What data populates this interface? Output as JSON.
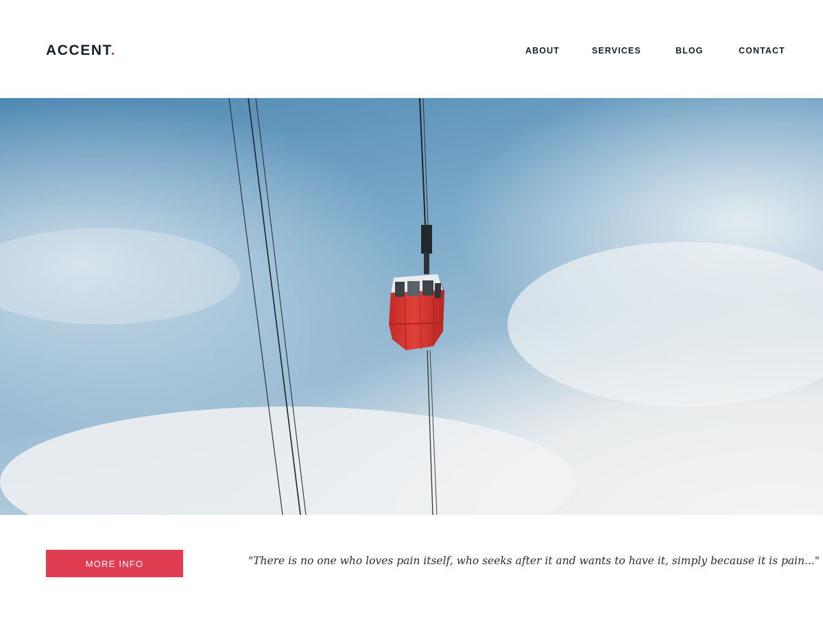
{
  "header": {
    "logo_text": "ACCENT",
    "logo_dot": ".",
    "nav": [
      "ABOUT",
      "SERVICES",
      "BLOG",
      "CONTACT"
    ]
  },
  "hero": {
    "image_subject": "red cable car gondola against cloudy blue sky"
  },
  "cta": {
    "more_info_label": "MORE INFO"
  },
  "quote": {
    "text": "\"There is no one who loves pain itself, who seeks after it and wants to have it, simply because it is pain...\""
  },
  "colors": {
    "accent": "#e03c52",
    "text_dark": "#16202b",
    "sky_blue": "#5a93b9",
    "gondola_red": "#d8362f"
  }
}
